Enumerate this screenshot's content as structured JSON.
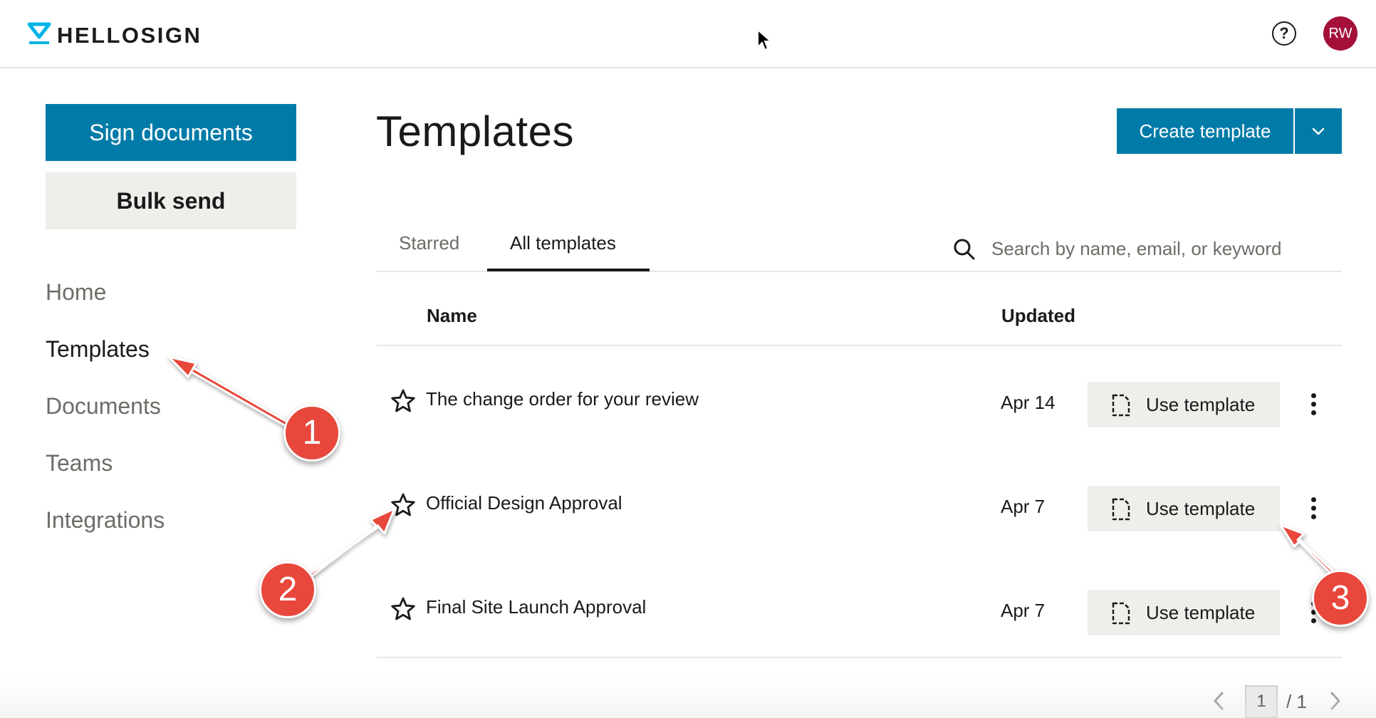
{
  "header": {
    "brand": "HELLOSIGN",
    "help_label": "?",
    "avatar_initials": "RW",
    "avatar_color": "#a5103b"
  },
  "sidebar": {
    "primary_button": "Sign documents",
    "secondary_button": "Bulk send",
    "nav": [
      {
        "label": "Home",
        "active": false
      },
      {
        "label": "Templates",
        "active": true
      },
      {
        "label": "Documents",
        "active": false
      },
      {
        "label": "Teams",
        "active": false
      },
      {
        "label": "Integrations",
        "active": false
      }
    ]
  },
  "main": {
    "title": "Templates",
    "create_button": "Create template",
    "tabs": [
      {
        "label": "Starred",
        "active": false
      },
      {
        "label": "All templates",
        "active": true
      }
    ],
    "search": {
      "placeholder": "Search by name, email, or keyword",
      "value": ""
    },
    "columns": {
      "name": "Name",
      "updated": "Updated"
    },
    "rows": [
      {
        "name": "The change order for your review",
        "updated": "Apr 14",
        "action": "Use template"
      },
      {
        "name": "Official Design Approval",
        "updated": "Apr 7",
        "action": "Use template"
      },
      {
        "name": "Final Site Launch Approval",
        "updated": "Apr 7",
        "action": "Use template"
      }
    ],
    "pagination": {
      "current": "1",
      "total": "/ 1"
    }
  },
  "annotations": [
    "1",
    "2",
    "3"
  ],
  "colors": {
    "accent": "#007ba8",
    "annotation": "#e8473b",
    "secondary_button_bg": "#efeeeb"
  },
  "icons": [
    "hellosign-logo-icon",
    "help-icon",
    "search-icon",
    "star-icon",
    "document-icon",
    "more-vertical-icon",
    "chevron-down-icon",
    "chevron-left-icon",
    "chevron-right-icon",
    "cursor-icon"
  ]
}
